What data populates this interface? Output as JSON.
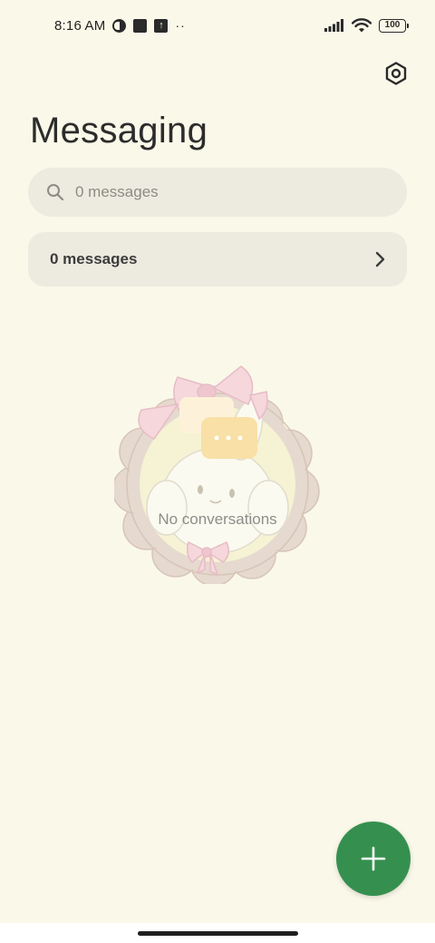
{
  "status_bar": {
    "time": "8:16 AM",
    "battery": "100"
  },
  "header": {
    "title": "Messaging"
  },
  "search": {
    "placeholder": "0 messages"
  },
  "unread_card": {
    "label": "0 messages"
  },
  "empty_state": {
    "text": "No conversations"
  },
  "colors": {
    "background": "#faf8e9",
    "card": "#edebdf",
    "fab": "#35904f"
  },
  "icons": {
    "settings": "settings-icon",
    "search": "search-icon",
    "chevron": "chevron-right-icon",
    "fab": "plus-icon"
  }
}
